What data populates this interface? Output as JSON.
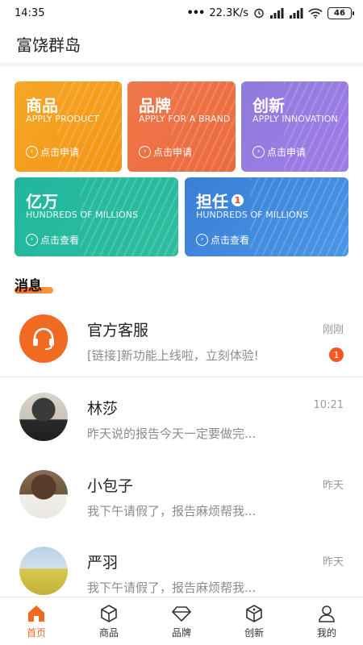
{
  "status_bar": {
    "time": "14:35",
    "network_speed": "22.3K/s",
    "battery": "46",
    "icons": [
      "notification-dots-icon",
      "alarm-icon",
      "signal-icon",
      "wifi-icon",
      "battery-icon"
    ]
  },
  "header": {
    "title": "富饶群岛"
  },
  "cards": {
    "product": {
      "title": "商品",
      "subtitle": "APPLY PRODUCT",
      "action": "点击申请"
    },
    "brand": {
      "title": "品牌",
      "subtitle": "APPLY FOR A BRAND",
      "action": "点击申请"
    },
    "innovation": {
      "title": "创新",
      "subtitle": "APPLY INNOVATION",
      "action": "点击申请"
    },
    "billion": {
      "title": "亿万",
      "subtitle": "HUNDREDS OF MILLIONS",
      "action": "点击查看"
    },
    "guarantee": {
      "title": "担任",
      "badge": "1",
      "subtitle": "HUNDREDS OF MILLIONS",
      "action": "点击查看"
    }
  },
  "messages": {
    "section_title": "消息",
    "items": [
      {
        "name": "官方客服",
        "preview": "[链接]新功能上线啦，立刻体验!",
        "time": "刚刚",
        "badge": "1"
      },
      {
        "name": "林莎",
        "preview": "昨天说的报告今天一定要做完...",
        "time": "10:21"
      },
      {
        "name": "小包子",
        "preview": "我下午请假了，报告麻烦帮我...",
        "time": "昨天"
      },
      {
        "name": "严羽",
        "preview": "我下午请假了，报告麻烦帮我...",
        "time": "昨天"
      }
    ]
  },
  "bottom_nav": {
    "items": [
      {
        "label": "首页",
        "icon": "home-icon"
      },
      {
        "label": "商品",
        "icon": "box-icon"
      },
      {
        "label": "品牌",
        "icon": "diamond-icon"
      },
      {
        "label": "创新",
        "icon": "cube-icon"
      },
      {
        "label": "我的",
        "icon": "user-icon"
      }
    ],
    "active_color": "#f06a22"
  },
  "colors": {
    "accent": "#f06a22",
    "card_product": "#f7a825",
    "card_brand": "#ee7145",
    "card_innovation": "#9a7be2",
    "card_billion": "#25b99e",
    "card_guarantee": "#3f87dd"
  }
}
